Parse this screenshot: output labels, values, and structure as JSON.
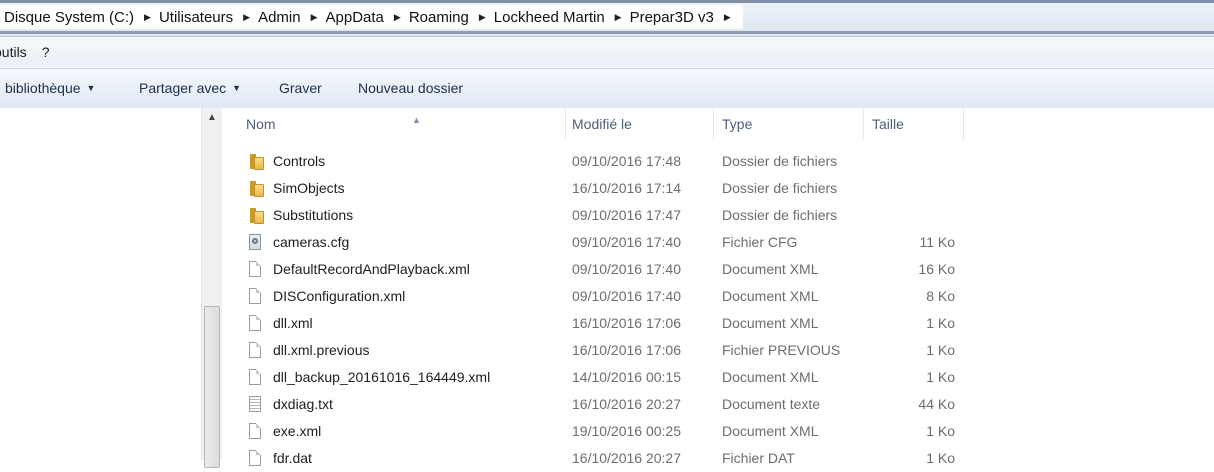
{
  "breadcrumbs": [
    "Disque System (C:)",
    "Utilisateurs",
    "Admin",
    "AppData",
    "Roaming",
    "Lockheed Martin",
    "Prepar3D v3"
  ],
  "menu": {
    "outils": "outils",
    "help": "?"
  },
  "toolbar": {
    "library": "bibliothèque",
    "share": "Partager avec",
    "burn": "Graver",
    "new_folder": "Nouveau dossier"
  },
  "columns": {
    "name": "Nom",
    "modified": "Modifié le",
    "type": "Type",
    "size": "Taille"
  },
  "sort": {
    "column": "name",
    "direction": "ascending"
  },
  "files": [
    {
      "name": "Controls",
      "modified": "09/10/2016 17:48",
      "type": "Dossier de fichiers",
      "size": "",
      "icon": "folder-icon"
    },
    {
      "name": "SimObjects",
      "modified": "16/10/2016 17:14",
      "type": "Dossier de fichiers",
      "size": "",
      "icon": "folder-icon"
    },
    {
      "name": "Substitutions",
      "modified": "09/10/2016 17:47",
      "type": "Dossier de fichiers",
      "size": "",
      "icon": "folder-icon"
    },
    {
      "name": "cameras.cfg",
      "modified": "09/10/2016 17:40",
      "type": "Fichier CFG",
      "size": "11 Ko",
      "icon": "config-file-icon"
    },
    {
      "name": "DefaultRecordAndPlayback.xml",
      "modified": "09/10/2016 17:40",
      "type": "Document XML",
      "size": "16 Ko",
      "icon": "file-icon"
    },
    {
      "name": "DISConfiguration.xml",
      "modified": "09/10/2016 17:40",
      "type": "Document XML",
      "size": "8 Ko",
      "icon": "file-icon"
    },
    {
      "name": "dll.xml",
      "modified": "16/10/2016 17:06",
      "type": "Document XML",
      "size": "1 Ko",
      "icon": "file-icon"
    },
    {
      "name": "dll.xml.previous",
      "modified": "16/10/2016 17:06",
      "type": "Fichier PREVIOUS",
      "size": "1 Ko",
      "icon": "file-icon"
    },
    {
      "name": "dll_backup_20161016_164449.xml",
      "modified": "14/10/2016 00:15",
      "type": "Document XML",
      "size": "1 Ko",
      "icon": "file-icon"
    },
    {
      "name": "dxdiag.txt",
      "modified": "16/10/2016 20:27",
      "type": "Document texte",
      "size": "44 Ko",
      "icon": "text-file-icon"
    },
    {
      "name": "exe.xml",
      "modified": "19/10/2016 00:25",
      "type": "Document XML",
      "size": "1 Ko",
      "icon": "file-icon"
    },
    {
      "name": "fdr.dat",
      "modified": "16/10/2016 20:27",
      "type": "Fichier DAT",
      "size": "1 Ko",
      "icon": "file-icon"
    }
  ]
}
